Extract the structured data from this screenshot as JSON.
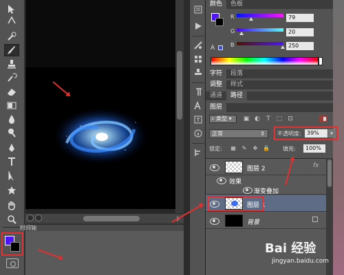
{
  "color_panel": {
    "tabs": [
      "颜色",
      "色板"
    ],
    "r_label": "R",
    "g_label": "G",
    "b_label": "B",
    "r_value": "79",
    "g_value": "20",
    "b_value": "250",
    "foreground_color": "#4f14fa",
    "background_color": "#000000"
  },
  "mid_tabs_1": [
    "字符",
    "段落"
  ],
  "mid_tabs_2": [
    "调整",
    "样式"
  ],
  "mid_tabs_3": [
    "通道",
    "路径"
  ],
  "layers_panel": {
    "tab": "图层",
    "kind": "类型",
    "blend_mode": "正常",
    "opacity_label": "不透明度:",
    "opacity_value": "39%",
    "lock_label": "锁定:",
    "fill_label": "填充:",
    "fill_value": "100%",
    "layers": [
      {
        "name": "图层 2",
        "fx": "fx"
      },
      {
        "name": "效果"
      },
      {
        "name": "渐变叠加"
      },
      {
        "name": "图层 1"
      },
      {
        "name": "背景"
      }
    ]
  },
  "timeline": {
    "label": "时间轴"
  },
  "watermark": {
    "logo": "Bai 经验",
    "url": "jingyan.baidu.com"
  },
  "colors": {
    "annotation": "#e23030",
    "selected_row": "#5e6d85"
  }
}
